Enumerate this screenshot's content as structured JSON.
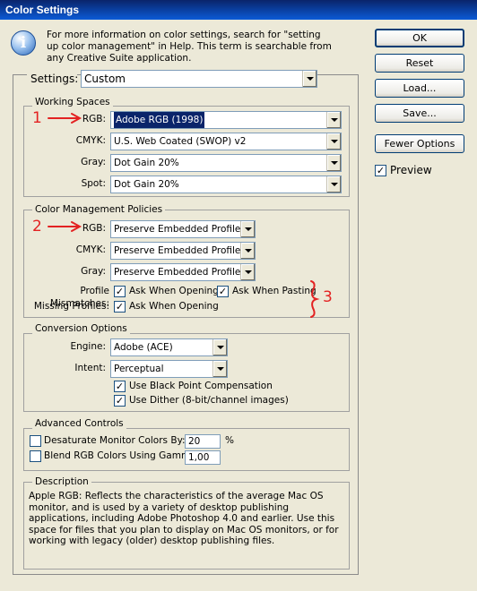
{
  "window": {
    "title": "Color Settings"
  },
  "info": {
    "text": "For more information on color settings, search for \"setting up color management\" in Help. This term is searchable from any Creative Suite application."
  },
  "settings": {
    "label": "Settings:",
    "value": "Custom"
  },
  "working_spaces": {
    "title": "Working Spaces",
    "rows": [
      {
        "label": "RGB:",
        "value": "Adobe RGB (1998)"
      },
      {
        "label": "CMYK:",
        "value": "U.S. Web Coated (SWOP) v2"
      },
      {
        "label": "Gray:",
        "value": "Dot Gain 20%"
      },
      {
        "label": "Spot:",
        "value": "Dot Gain 20%"
      }
    ]
  },
  "cm_policies": {
    "title": "Color Management Policies",
    "rows": [
      {
        "label": "RGB:",
        "value": "Preserve Embedded Profiles"
      },
      {
        "label": "CMYK:",
        "value": "Preserve Embedded Profiles"
      },
      {
        "label": "Gray:",
        "value": "Preserve Embedded Profiles"
      }
    ],
    "profile_mismatches": {
      "label": "Profile Mismatches:",
      "ask_opening": "Ask When Opening",
      "ask_pasting": "Ask When Pasting"
    },
    "missing_profiles": {
      "label": "Missing Profiles:",
      "ask_opening": "Ask When Opening"
    }
  },
  "conversion": {
    "title": "Conversion Options",
    "engine": {
      "label": "Engine:",
      "value": "Adobe (ACE)"
    },
    "intent": {
      "label": "Intent:",
      "value": "Perceptual"
    },
    "black_point": "Use Black Point Compensation",
    "dither": "Use Dither (8-bit/channel images)"
  },
  "advanced": {
    "title": "Advanced Controls",
    "desaturate": {
      "label": "Desaturate Monitor Colors By:",
      "value": "20",
      "unit": "%"
    },
    "blend": {
      "label": "Blend RGB Colors Using Gamma:",
      "value": "1,00"
    }
  },
  "description": {
    "title": "Description",
    "text": "Apple RGB:  Reflects the characteristics of the average Mac OS monitor, and is used by a variety of desktop publishing applications, including Adobe Photoshop 4.0 and earlier.  Use this space for files that you plan to display on Mac OS monitors, or for working with legacy (older) desktop publishing files."
  },
  "buttons": {
    "ok": "OK",
    "reset": "Reset",
    "load": "Load...",
    "save": "Save...",
    "fewer_options": "Fewer Options",
    "preview": "Preview"
  },
  "annotations": {
    "one": "1",
    "two": "2",
    "three": "3",
    "color": "#e32222"
  },
  "colors": {
    "title_bar": "#0a246a",
    "selection": "#0a246a",
    "dialog_bg": "#ece9d8"
  }
}
